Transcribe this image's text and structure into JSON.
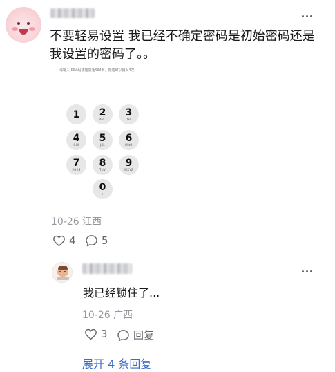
{
  "comment": {
    "text": "不要轻易设置 我已经不确定密码是初始密码还是我设置的密码了。。",
    "date": "10-26",
    "location": "江西",
    "likes": "4",
    "replies": "5"
  },
  "attached_image": {
    "caption": "请输入 PIN 码才能激活SIM卡，你还可以输入3次。",
    "keys": [
      {
        "num": "1",
        "sub": ""
      },
      {
        "num": "2",
        "sub": "ABC"
      },
      {
        "num": "3",
        "sub": "DEF"
      },
      {
        "num": "4",
        "sub": "GHI"
      },
      {
        "num": "5",
        "sub": "JKL"
      },
      {
        "num": "6",
        "sub": "MNO"
      },
      {
        "num": "7",
        "sub": "PQRS"
      },
      {
        "num": "8",
        "sub": "TUV"
      },
      {
        "num": "9",
        "sub": "WXYZ"
      },
      {
        "num": "0",
        "sub": "+"
      }
    ]
  },
  "reply": {
    "text": "我已经锁住了...",
    "date": "10-26",
    "location": "广西",
    "likes": "3",
    "reply_label": "回复"
  },
  "expand_label": "展开 4 条回复",
  "colors": {
    "link": "#3a6ec2",
    "meta": "#9499a0",
    "key_bg": "#e7e7e7"
  }
}
